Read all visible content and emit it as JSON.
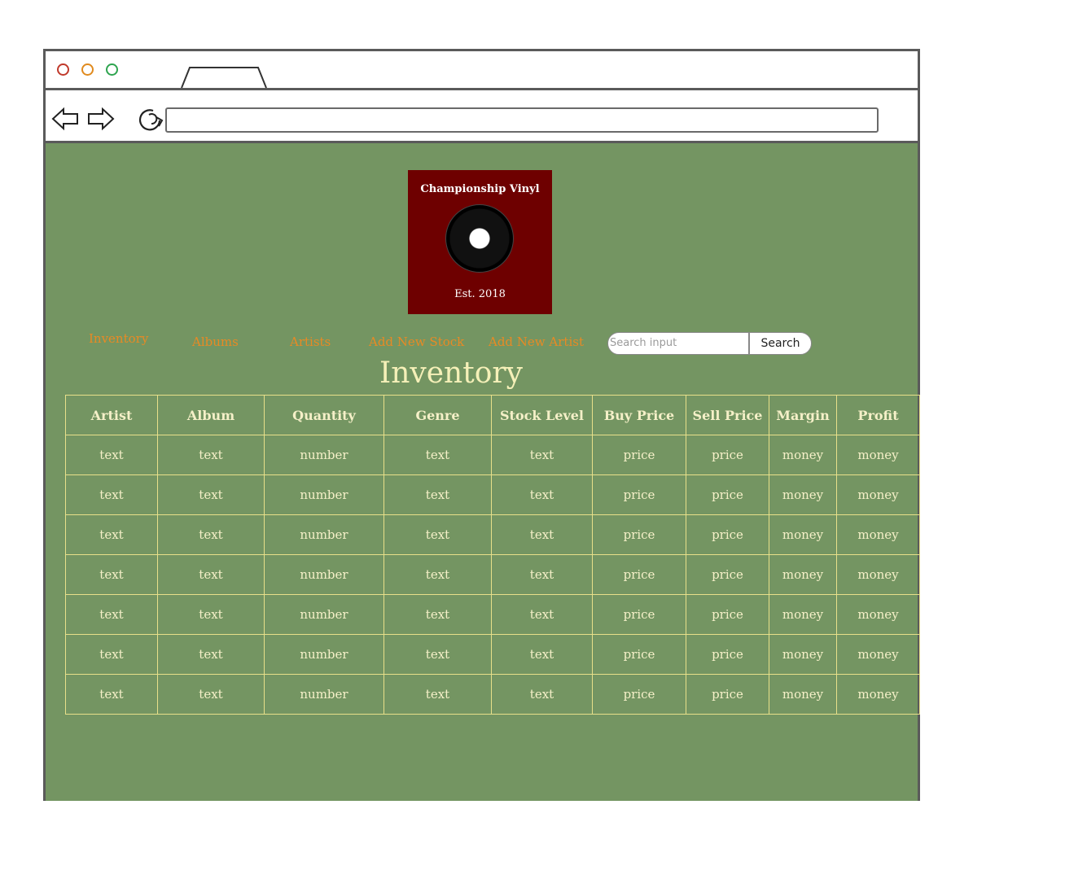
{
  "browser": {
    "window_dots": [
      "close",
      "minimize",
      "maximize"
    ],
    "address_value": ""
  },
  "logo": {
    "title": "Championship Vinyl",
    "est": "Est. 2018",
    "bg_color": "#6e0000"
  },
  "nav": {
    "items": [
      {
        "label": "Inventory"
      },
      {
        "label": "Albums"
      },
      {
        "label": "Artists"
      },
      {
        "label": "Add New Stock"
      },
      {
        "label": "Add New Artist"
      }
    ],
    "color": "#e88a24"
  },
  "search": {
    "placeholder": "Search input",
    "button_label": "Search"
  },
  "page": {
    "title": "Inventory",
    "bg_color": "#749562"
  },
  "table": {
    "headers": [
      "Artist",
      "Album",
      "Quantity",
      "Genre",
      "Stock Level",
      "Buy Price",
      "Sell Price",
      "Margin",
      "Profit"
    ],
    "rows": [
      [
        "text",
        "text",
        "number",
        "text",
        "text",
        "price",
        "price",
        "money",
        "money"
      ],
      [
        "text",
        "text",
        "number",
        "text",
        "text",
        "price",
        "price",
        "money",
        "money"
      ],
      [
        "text",
        "text",
        "number",
        "text",
        "text",
        "price",
        "price",
        "money",
        "money"
      ],
      [
        "text",
        "text",
        "number",
        "text",
        "text",
        "price",
        "price",
        "money",
        "money"
      ],
      [
        "text",
        "text",
        "number",
        "text",
        "text",
        "price",
        "price",
        "money",
        "money"
      ],
      [
        "text",
        "text",
        "number",
        "text",
        "text",
        "price",
        "price",
        "money",
        "money"
      ],
      [
        "text",
        "text",
        "number",
        "text",
        "text",
        "price",
        "price",
        "money",
        "money"
      ]
    ]
  }
}
